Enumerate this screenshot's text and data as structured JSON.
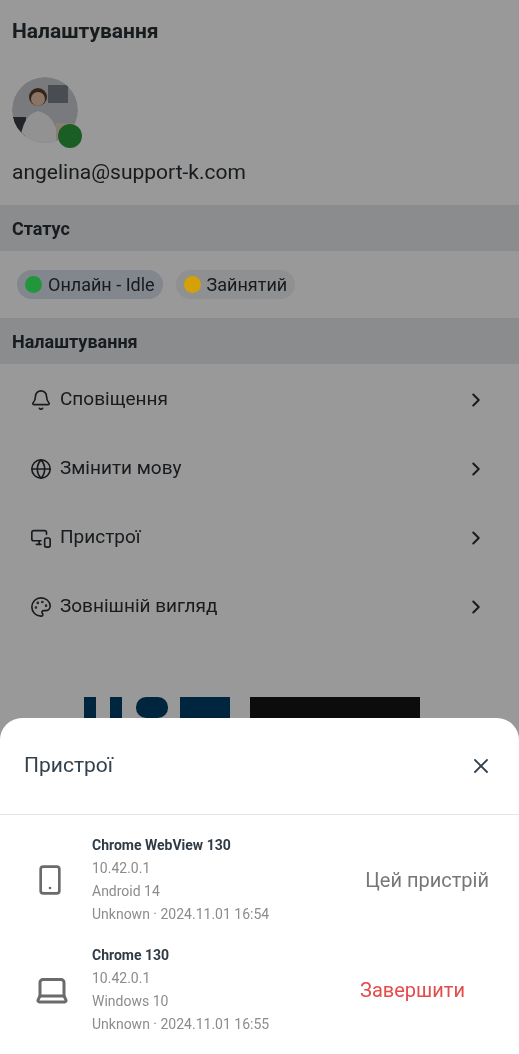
{
  "page": {
    "title": "Налаштування"
  },
  "profile": {
    "online": true,
    "email": "angelina@support-k.com"
  },
  "status_section": {
    "label": "Статус",
    "statuses": [
      {
        "label": "Онлайн - Idle",
        "color": "#22963a",
        "selected": true
      },
      {
        "label": "Зайнятий",
        "color": "#d4a106",
        "selected": false
      }
    ]
  },
  "settings_section": {
    "label": "Налаштування",
    "items": [
      {
        "label": "Сповіщення",
        "kind": "bell"
      },
      {
        "label": "Змінити мову",
        "kind": "globe"
      },
      {
        "label": "Пристрої",
        "kind": "devices"
      },
      {
        "label": "Зовнішній вигляд",
        "kind": "palette"
      }
    ]
  },
  "sheet": {
    "title": "Пристрої",
    "devices": [
      {
        "name": "Chrome WebView 130",
        "ip": "10.42.0.1",
        "os": "Android 14",
        "seen": "Unknown · 2024.11.01 16:54",
        "kind": "phone",
        "action": {
          "text": "Цей пристрій",
          "kind": "current"
        }
      },
      {
        "name": "Chrome 130",
        "ip": "10.42.0.1",
        "os": "Windows 10",
        "seen": "Unknown · 2024.11.01 16:55",
        "kind": "laptop",
        "action": {
          "text": "Завершити",
          "kind": "terminate"
        }
      }
    ]
  }
}
